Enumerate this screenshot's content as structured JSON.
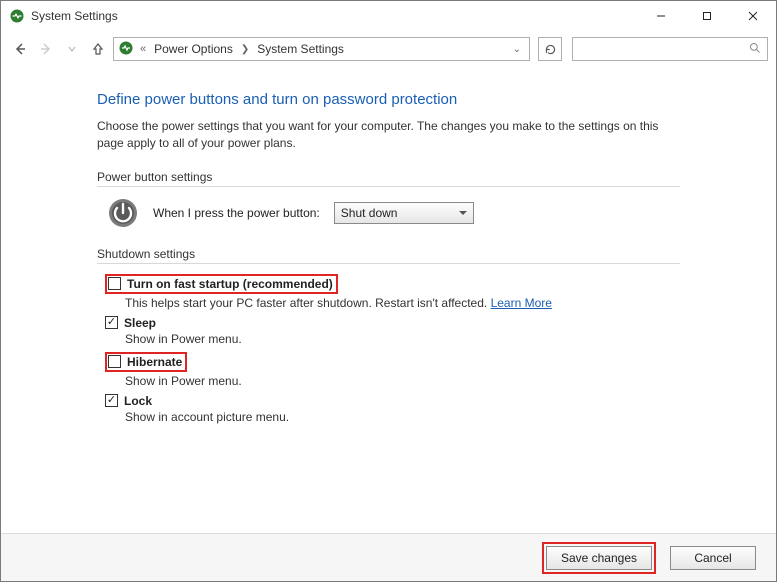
{
  "window": {
    "title": "System Settings"
  },
  "breadcrumb": {
    "item1": "Power Options",
    "item2": "System Settings"
  },
  "main": {
    "heading": "Define power buttons and turn on password protection",
    "sub": "Choose the power settings that you want for your computer. The changes you make to the settings on this page apply to all of your power plans.",
    "powerSection": "Power button settings",
    "powerLabel": "When I press the power button:",
    "powerSelected": "Shut down",
    "shutdownSection": "Shutdown settings",
    "opts": {
      "fast": {
        "label": "Turn on fast startup (recommended)",
        "desc_a": "This helps start your PC faster after shutdown. Restart isn't affected. ",
        "learn": "Learn More"
      },
      "sleep": {
        "label": "Sleep",
        "desc": "Show in Power menu."
      },
      "hibernate": {
        "label": "Hibernate",
        "desc": "Show in Power menu."
      },
      "lock": {
        "label": "Lock",
        "desc": "Show in account picture menu."
      }
    }
  },
  "footer": {
    "save": "Save changes",
    "cancel": "Cancel"
  }
}
